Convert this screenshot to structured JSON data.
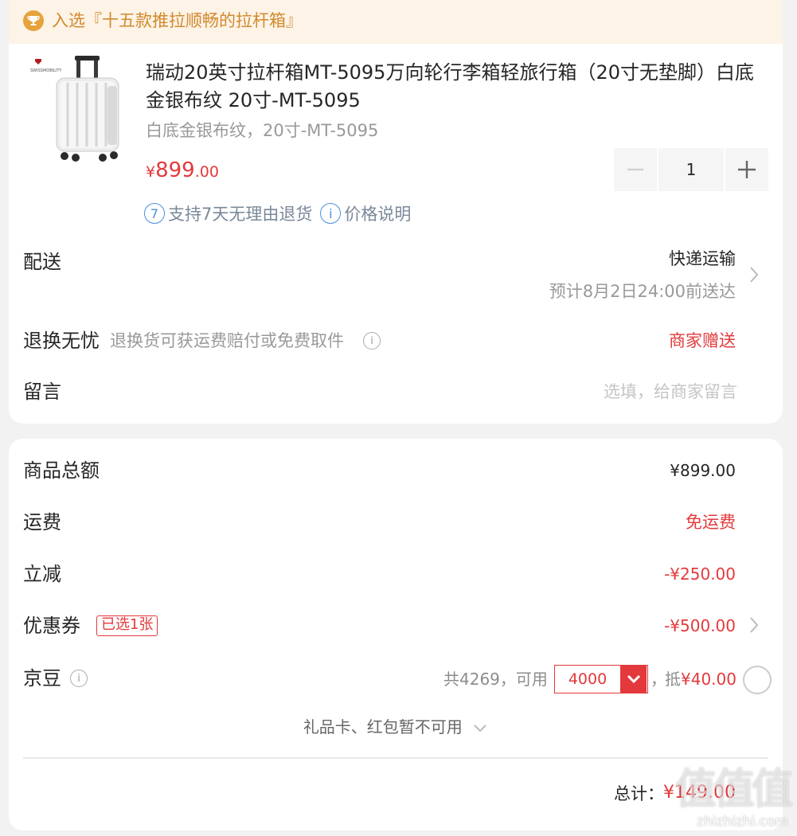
{
  "banner": {
    "text": "入选『十五款推拉顺畅的拉杆箱』"
  },
  "product": {
    "brand_logo_text": "SWISSMOBILITY",
    "title": "瑞动20英寸拉杆箱MT-5095万向轮行李箱轻旅行箱（20寸无垫脚）白底金银布纹 20寸-MT-5095",
    "spec": "白底金银布纹，20寸-MT-5095",
    "price_symbol": "¥",
    "price_int": "899",
    "price_dec": ".00",
    "quantity": "1",
    "service_badge": "7",
    "service_text": "支持7天无理由退货",
    "price_info_badge": "i",
    "price_info_text": "价格说明"
  },
  "delivery": {
    "label": "配送",
    "method": "快递运输",
    "eta": "预计8月2日24:00前送达"
  },
  "returns": {
    "label": "退换无忧",
    "description": "退换货可获运费赔付或免费取件",
    "gift": "商家赠送"
  },
  "message": {
    "label": "留言",
    "placeholder": "选填，给商家留言"
  },
  "summary": {
    "subtotal_label": "商品总额",
    "subtotal_value": "¥899.00",
    "shipping_label": "运费",
    "shipping_value": "免运费",
    "discount_label": "立减",
    "discount_value": "-¥250.00",
    "coupon_label": "优惠券",
    "coupon_badge": "已选1张",
    "coupon_value": "-¥500.00",
    "beans_label": "京豆",
    "beans_total": "共4269，可用",
    "beans_selected": "4000",
    "beans_sep": "，",
    "beans_deduct_prefix": "抵",
    "beans_deduct_amount": "¥40.00",
    "gift_card_note": "礼品卡、红包暂不可用",
    "total_label": "总计：",
    "total_value": "¥149.00"
  },
  "watermark": {
    "logo": "值值值",
    "url": "zhizhizhi.com"
  },
  "colors": {
    "accent_red": "#e4393c",
    "banner_bg": "#fdf3e7",
    "banner_text": "#d18a2c",
    "info_blue": "#4a90e2"
  }
}
